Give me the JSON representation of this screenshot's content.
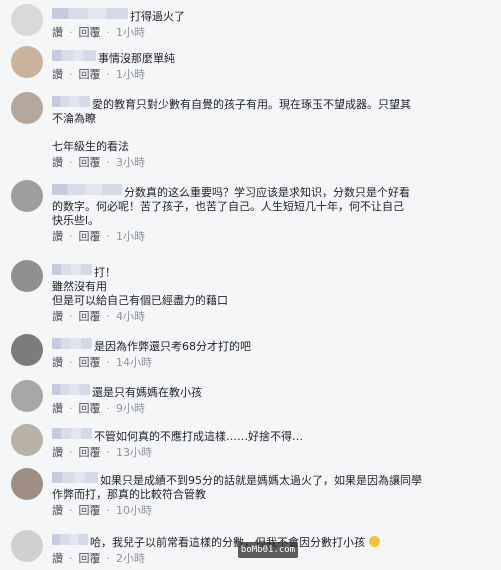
{
  "comments": [
    {
      "text": "打得過火了",
      "actions": [
        "讚",
        "回覆"
      ],
      "time": "1小時"
    },
    {
      "text": "事情沒那麼單純",
      "actions": [
        "讚",
        "回覆"
      ],
      "time": "1小時"
    },
    {
      "text": "愛的教育只對少數有自覺的孩子有用。現在琢玉不望成器。只望其\n不淪為瞭\n\n七年級生的看法",
      "actions": [
        "讚",
        "回覆"
      ],
      "time": "3小時"
    },
    {
      "text": "分数真的这么重要吗？学习应该是求知识，分数只是个好看\n的数字。何必呢！苦了孩子，也苦了自己。人生短短几十年，何不让自己\n快乐些l。",
      "actions": [
        "讚",
        "回覆"
      ],
      "time": "1小時"
    },
    {
      "text": "打！\n雖然沒有用\n但是可以給自己有個已經盡力的藉口",
      "actions": [
        "讚",
        "回覆"
      ],
      "time": "4小時"
    },
    {
      "text": "是因為作弊還只考68分才打的吧",
      "actions": [
        "讚",
        "回覆"
      ],
      "time": "14小時"
    },
    {
      "text": "還是只有媽媽在教小孩",
      "actions": [
        "讚",
        "回覆"
      ],
      "time": "9小時"
    },
    {
      "text": "不管如何真的不應打成這樣……好捨不得…",
      "actions": [
        "讚",
        "回覆"
      ],
      "time": "13小時"
    },
    {
      "text": "如果只是成績不到95分的話就是媽媽太過火了，如果是因為讓同學\n作弊而打，那真的比較符合管教",
      "actions": [
        "讚",
        "回覆"
      ],
      "time": "10小時"
    },
    {
      "text": "哈，我兒子以前常看這樣的分數，但我不會因分數打小孩",
      "actions": [
        "讚",
        "回覆"
      ],
      "time": "2小時"
    }
  ],
  "watermark": "boMb01.com"
}
